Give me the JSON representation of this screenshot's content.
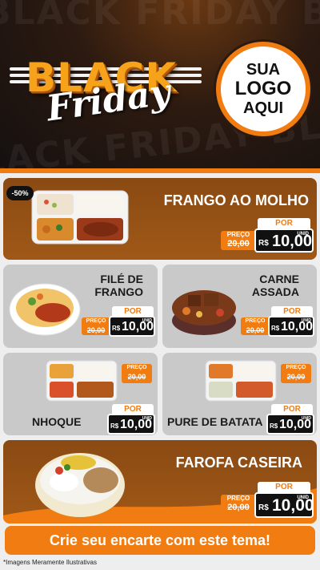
{
  "banner": {
    "background_words": "BLACK FRIDAY BLACK FRIDAY",
    "brand_word_1": "BLACK",
    "brand_word_2": "Friday",
    "logo_line_1": "SUA",
    "logo_line_2": "LOGO",
    "logo_line_3": "AQUI"
  },
  "colors": {
    "accent": "#f07c12",
    "card_brown": "#8a4a13",
    "card_gray": "#c9c9c9",
    "price_box": "#111111"
  },
  "labels": {
    "preco": "PREÇO",
    "por": "POR",
    "currency": "R$",
    "unid": "UNID"
  },
  "discount_badge": "-50%",
  "products": [
    {
      "title": "FRANGO AO MOLHO",
      "old_price": "20,00",
      "price": "10,00"
    },
    {
      "title_line_1": "FILÉ DE",
      "title_line_2": "FRANGO",
      "old_price": "20,00",
      "price": "10,00"
    },
    {
      "title_line_1": "CARNE",
      "title_line_2": "ASSADA",
      "old_price": "20,00",
      "price": "10,00"
    },
    {
      "title": "NHOQUE",
      "old_price": "20,00",
      "price": "10,00"
    },
    {
      "title": "PURE DE BATATA",
      "old_price": "20,00",
      "price": "10,00"
    },
    {
      "title": "FAROFA CASEIRA",
      "old_price": "20,00",
      "price": "10,00"
    }
  ],
  "cta_text": "Crie seu encarte com este tema!",
  "footnote": "*Imagens Meramente Ilustrativas"
}
